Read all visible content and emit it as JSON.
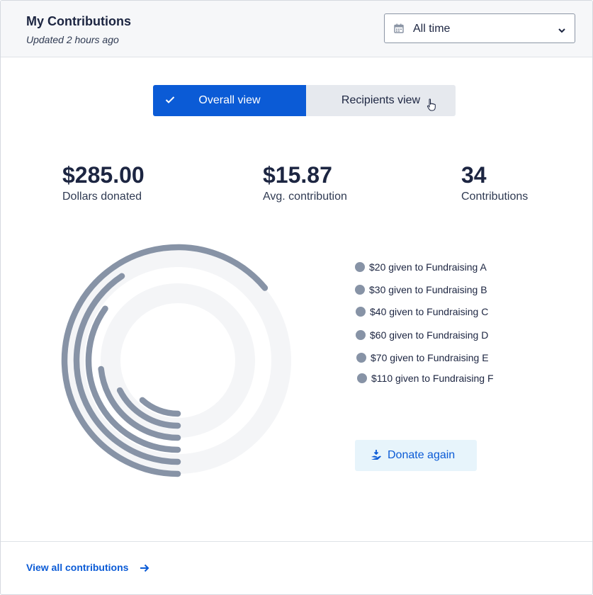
{
  "header": {
    "title": "My Contributions",
    "subtitle": "Updated 2 hours ago",
    "period_select": {
      "value": "All time",
      "icon": "calendar-icon"
    }
  },
  "view_toggle": {
    "options": [
      {
        "label": "Overall view",
        "selected": true
      },
      {
        "label": "Recipients view",
        "selected": false
      }
    ]
  },
  "stats": [
    {
      "value": "$285.00",
      "label": "Dollars donated"
    },
    {
      "value": "$15.87",
      "label": "Avg. contribution"
    },
    {
      "value": "34",
      "label": "Contributions"
    }
  ],
  "chart_data": {
    "type": "radial-bar",
    "series": [
      {
        "label": "$20 given to Fundraising A",
        "value": 20
      },
      {
        "label": "$30 given to Fundraising B",
        "value": 30
      },
      {
        "label": "$40 given to Fundraising C",
        "value": 40
      },
      {
        "label": "$60 given to Fundraising D",
        "value": 60
      },
      {
        "label": "$70 given to Fundraising E",
        "value": 70
      },
      {
        "label": "$110 given to Fundraising F",
        "value": 110
      }
    ],
    "colors": {
      "bar": "#8793a6",
      "track": "#f4f5f7"
    }
  },
  "actions": {
    "donate_label": "Donate again",
    "view_all_label": "View all contributions"
  },
  "colors": {
    "accent": "#0b5bd6",
    "text": "#1c2541"
  }
}
